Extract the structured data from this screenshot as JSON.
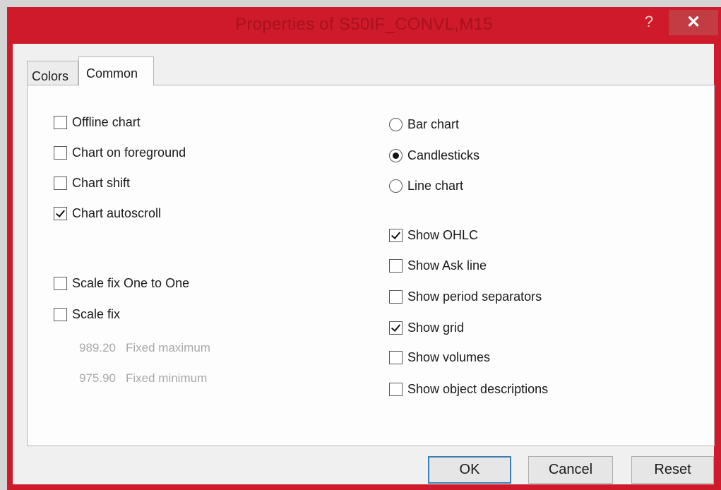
{
  "window": {
    "title": "Properties of S50IF_CONVL,M15",
    "help_label": "?",
    "close_label": "✕"
  },
  "tabs": [
    {
      "label": "Colors",
      "active": false
    },
    {
      "label": "Common",
      "active": true
    }
  ],
  "left_options": [
    {
      "label": "Offline chart",
      "checked": false
    },
    {
      "label": "Chart on foreground",
      "checked": false
    },
    {
      "label": "Chart shift",
      "checked": false
    },
    {
      "label": "Chart autoscroll",
      "checked": true
    },
    {
      "label": "Scale fix One to One",
      "checked": false
    },
    {
      "label": "Scale fix",
      "checked": false
    }
  ],
  "scale_fields": {
    "max_value": "989.20",
    "max_label": "Fixed maximum",
    "min_value": "975.90",
    "min_label": "Fixed minimum"
  },
  "chart_types": [
    {
      "label": "Bar chart",
      "selected": false
    },
    {
      "label": "Candlesticks",
      "selected": true
    },
    {
      "label": "Line chart",
      "selected": false
    }
  ],
  "right_options": [
    {
      "label": "Show OHLC",
      "checked": true
    },
    {
      "label": "Show Ask line",
      "checked": false
    },
    {
      "label": "Show period separators",
      "checked": false
    },
    {
      "label": "Show grid",
      "checked": true
    },
    {
      "label": "Show volumes",
      "checked": false
    },
    {
      "label": "Show object descriptions",
      "checked": false
    }
  ],
  "buttons": {
    "ok": "OK",
    "cancel": "Cancel",
    "reset": "Reset"
  },
  "colors": {
    "titlebar": "#ce1a2a",
    "close_button": "#c23c44",
    "default_button_border": "#3c7fb1"
  }
}
